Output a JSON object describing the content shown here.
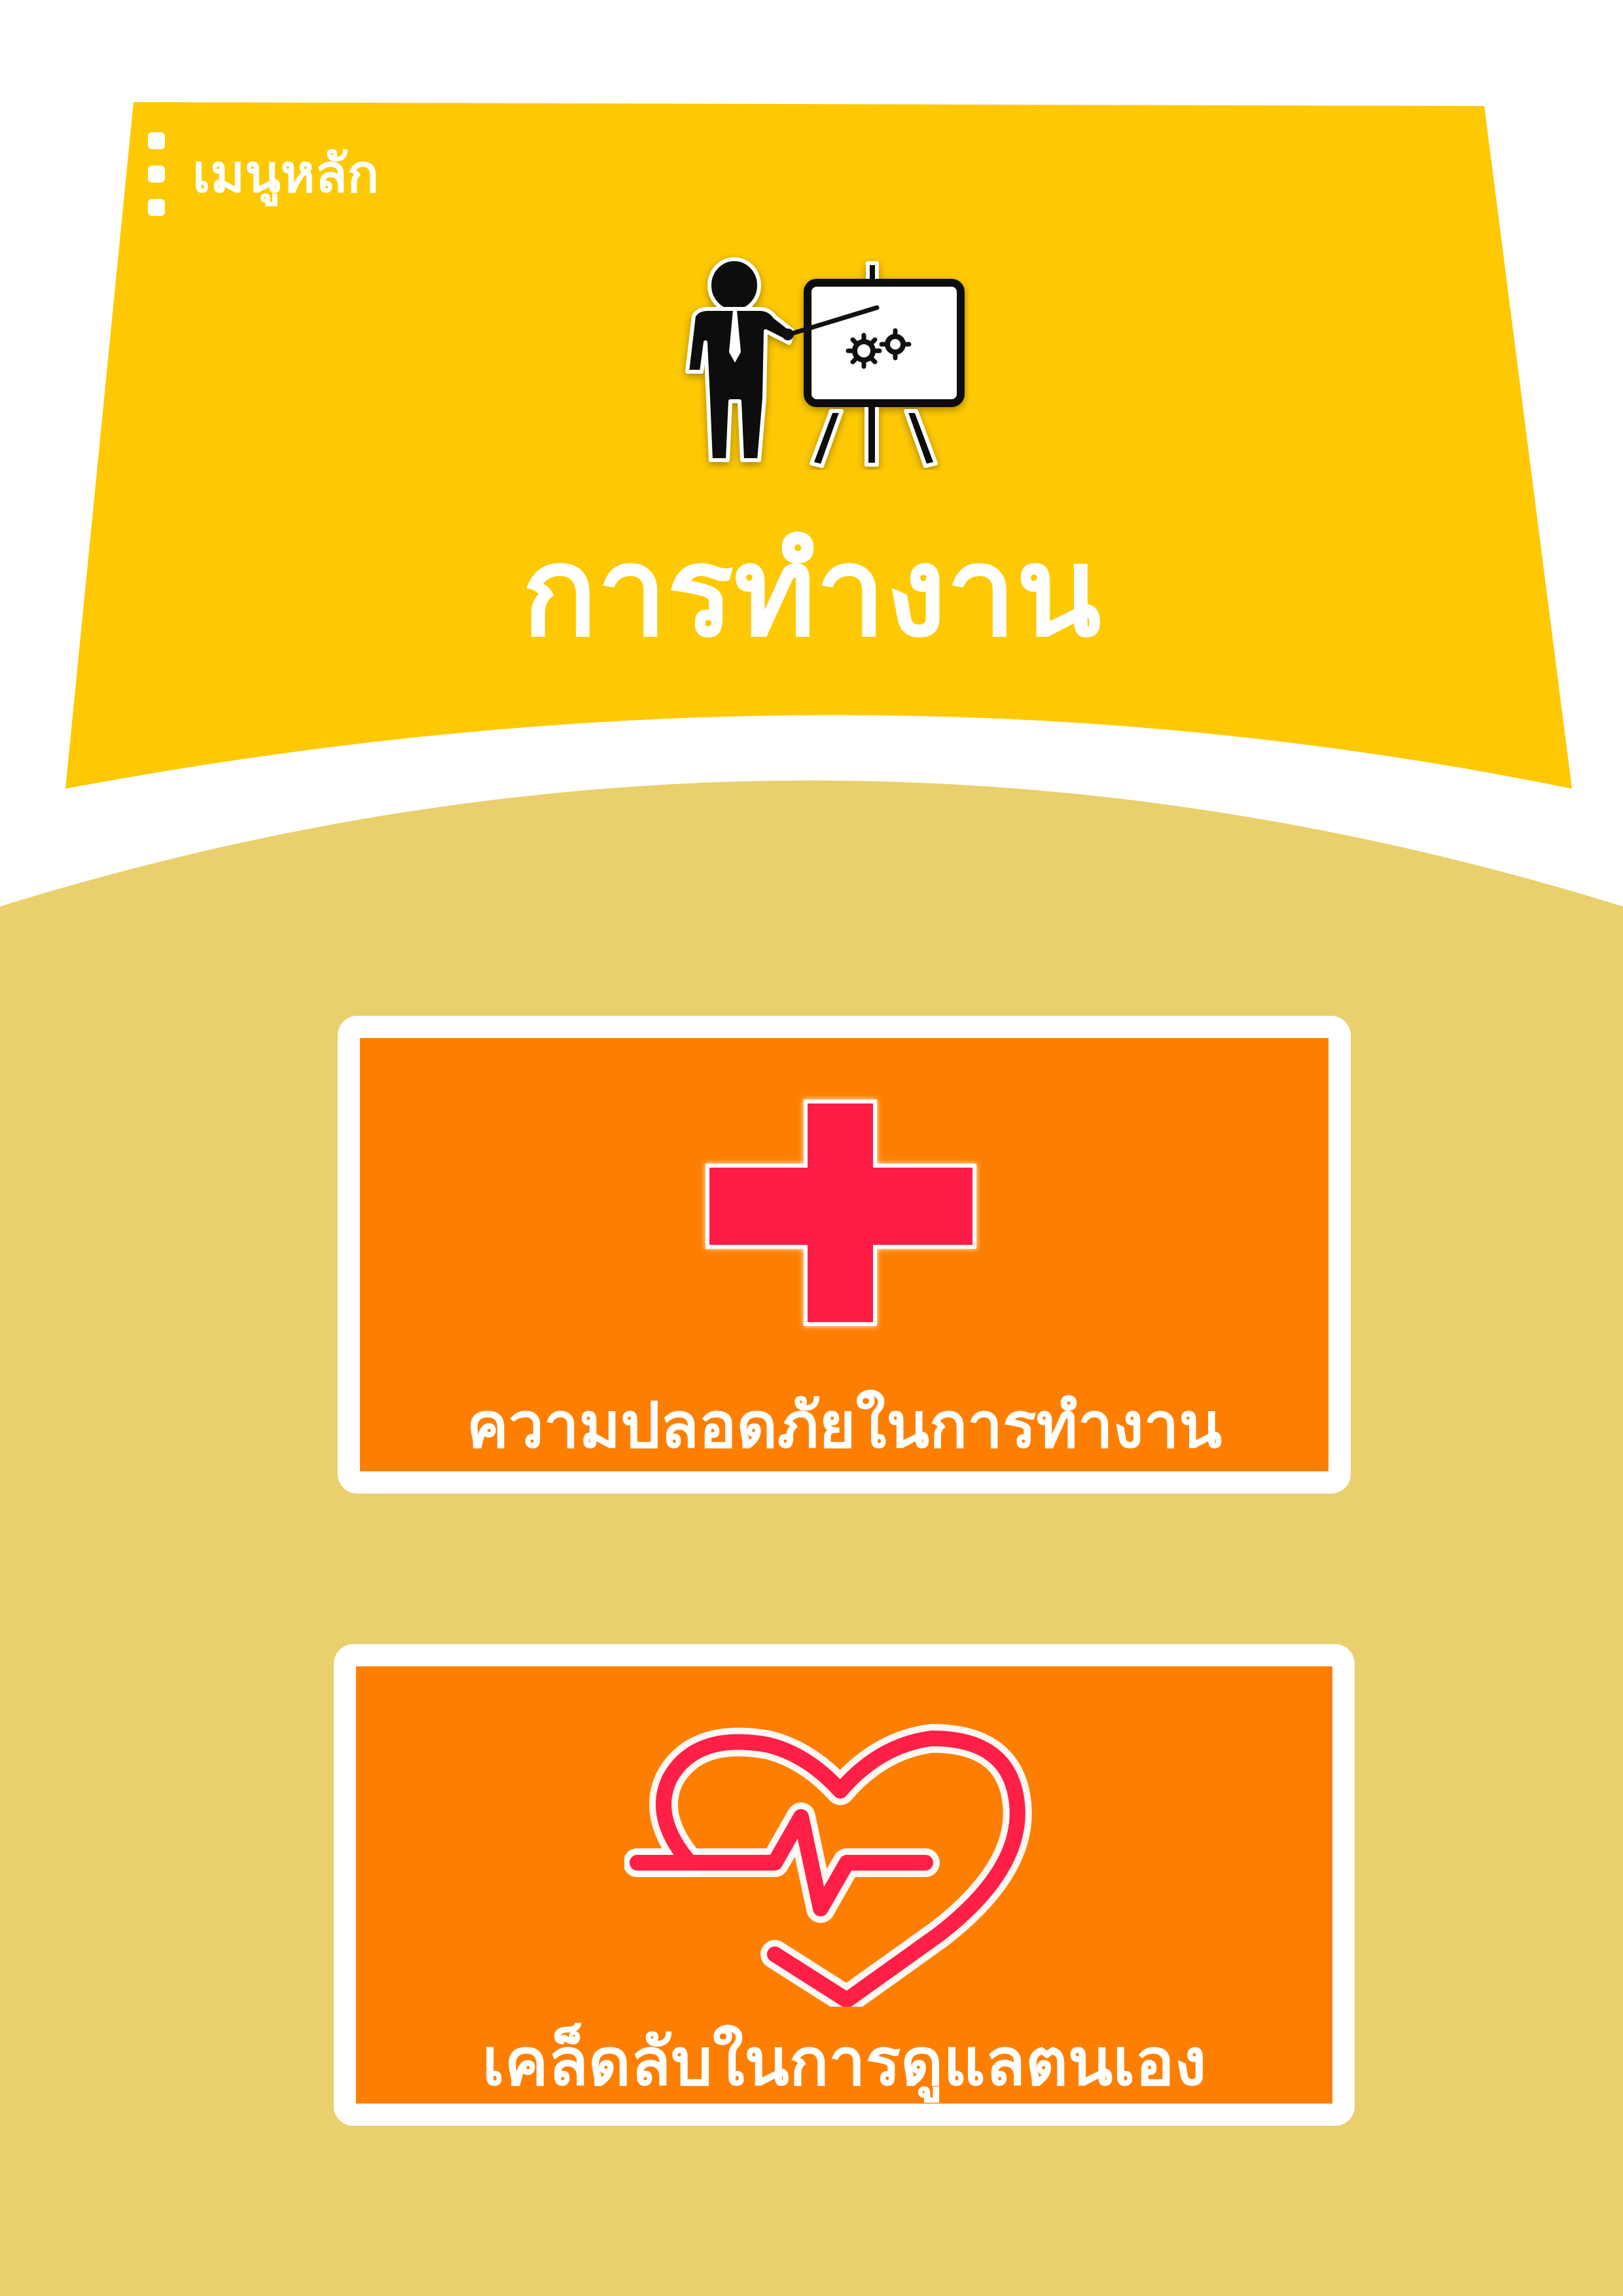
{
  "header": {
    "menu_label": "เมนูหลัก",
    "title": "การทำงาน",
    "hero_icon": "presenter-easel-icon"
  },
  "cards": [
    {
      "label": "ความปลอดภัยในการทำงาน",
      "icon": "red-cross-icon"
    },
    {
      "label": "เคล็ดลับในการดูแลตนเอง",
      "icon": "heartbeat-icon"
    }
  ],
  "colors": {
    "header_yellow": "#fec903",
    "body_tan": "#e9d06c",
    "card_orange": "#fe7f00",
    "icon_red": "#ff1f47",
    "text_white": "#ffffff"
  }
}
